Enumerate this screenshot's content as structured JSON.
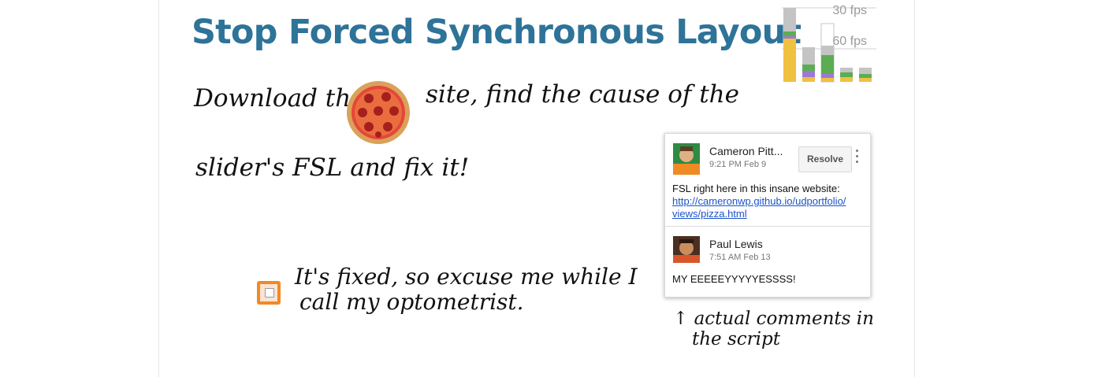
{
  "slide": {
    "title": "Stop Forced Synchronous Layout",
    "instruction_part1": "Download the",
    "instruction_part2": "site, find the cause of the",
    "instruction_line2": "slider's FSL and fix it!",
    "fixed_note_line1": "It's fixed, so excuse me while I",
    "fixed_note_line2": "call my optometrist.",
    "comment_note_line1": "↑ actual comments in",
    "comment_note_line2": "the script"
  },
  "fps_chart": {
    "label_30": "30 fps",
    "label_60": "60 fps",
    "colors": {
      "yellow": "#f0c040",
      "purple": "#9b7ad6",
      "green": "#5cad52",
      "gray": "#c4c4c4"
    }
  },
  "comment_thread": {
    "first": {
      "author": "Cameron Pitt...",
      "time": "9:21 PM Feb 9",
      "resolve_label": "Resolve",
      "text": "FSL right here in this insane website:",
      "link_line1": "http://cameronwp.github.io/udportfolio/",
      "link_line2": "views/pizza.html"
    },
    "reply": {
      "author": "Paul Lewis",
      "time": "7:51 AM Feb 13",
      "text": "MY EEEEEYYYYYESSSS!"
    }
  }
}
